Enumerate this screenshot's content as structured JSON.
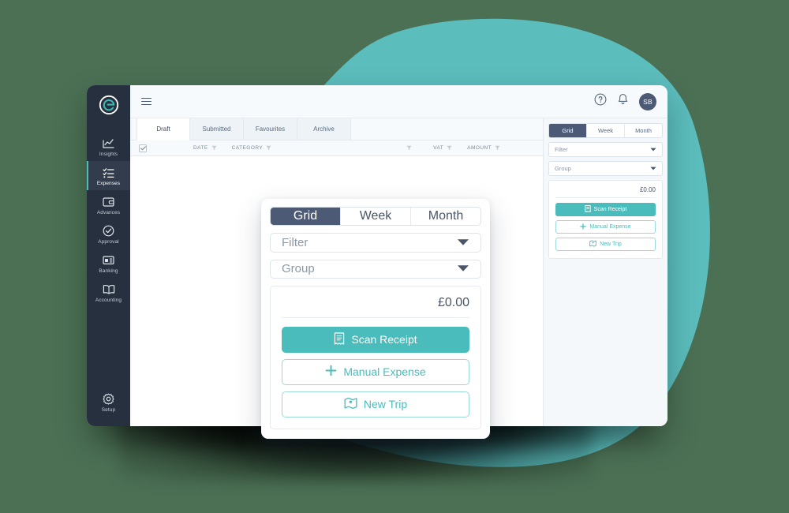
{
  "theme": {
    "background_green": "#4b7054",
    "blob_teal": "#5bbdbc",
    "accent_teal": "#49bcbb",
    "sidebar_navy": "#27303f",
    "active_tab_navy": "#4d5a75",
    "panel_bg": "#f5f8fa"
  },
  "sidebar": {
    "logo": "e",
    "items": [
      {
        "label": "Insights",
        "icon": "chart-line-icon",
        "active": false
      },
      {
        "label": "Expenses",
        "icon": "list-check-icon",
        "active": true
      },
      {
        "label": "Advances",
        "icon": "wallet-icon",
        "active": false
      },
      {
        "label": "Approval",
        "icon": "check-circle-icon",
        "active": false
      },
      {
        "label": "Banking",
        "icon": "bank-card-icon",
        "active": false
      },
      {
        "label": "Accounting",
        "icon": "book-icon",
        "active": false
      }
    ],
    "setup": {
      "label": "Setup",
      "icon": "gear-icon"
    }
  },
  "topbar": {
    "menu_icon": "hamburger-icon",
    "help_icon": "help-circle-icon",
    "notifications_icon": "bell-icon",
    "avatar_initials": "SB"
  },
  "tabs": [
    {
      "label": "Draft",
      "active": true
    },
    {
      "label": "Submitted",
      "active": false
    },
    {
      "label": "Favourites",
      "active": false
    },
    {
      "label": "Archive",
      "active": false
    }
  ],
  "table": {
    "select_all_checked": true,
    "columns": [
      {
        "label": "DATE",
        "has_filter": true
      },
      {
        "label": "CATEGORY",
        "has_filter": true
      },
      {
        "label": "",
        "has_filter": true
      },
      {
        "label": "VAT",
        "has_filter": true
      },
      {
        "label": "AMOUNT",
        "has_filter": true
      }
    ],
    "rows": []
  },
  "right_panel": {
    "view_modes": [
      {
        "label": "Grid",
        "active": true
      },
      {
        "label": "Week",
        "active": false
      },
      {
        "label": "Month",
        "active": false
      }
    ],
    "filter_select": {
      "value": "Filter",
      "caret": "chevron-down-icon"
    },
    "group_select": {
      "value": "Group",
      "caret": "chevron-down-icon"
    },
    "amount_total": "£0.00",
    "actions": [
      {
        "label": "Scan Receipt",
        "icon": "receipt-icon",
        "style": "primary"
      },
      {
        "label": "Manual Expense",
        "icon": "plus-icon",
        "style": "outline"
      },
      {
        "label": "New Trip",
        "icon": "map-icon",
        "style": "outline"
      }
    ]
  },
  "zoom_popup": {
    "view_modes": [
      {
        "label": "Grid",
        "active": true
      },
      {
        "label": "Week",
        "active": false
      },
      {
        "label": "Month",
        "active": false
      }
    ],
    "filter_select": {
      "value": "Filter",
      "caret": "chevron-down-icon"
    },
    "group_select": {
      "value": "Group",
      "caret": "chevron-down-icon"
    },
    "amount_total": "£0.00",
    "actions": [
      {
        "label": "Scan Receipt",
        "icon": "receipt-icon",
        "style": "primary"
      },
      {
        "label": "Manual Expense",
        "icon": "plus-icon",
        "style": "outline"
      },
      {
        "label": "New Trip",
        "icon": "map-icon",
        "style": "outline"
      }
    ]
  }
}
